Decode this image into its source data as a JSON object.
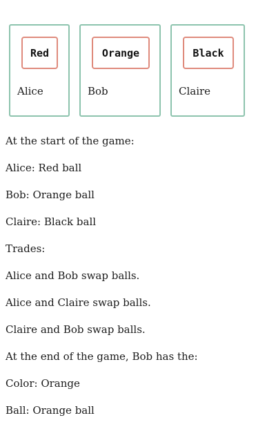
{
  "players": [
    {
      "name": "Alice",
      "ball": "Red"
    },
    {
      "name": "Bob",
      "ball": "Orange"
    },
    {
      "name": "Claire",
      "ball": "Black"
    }
  ],
  "colors": {
    "card_border": "#8cc3ad",
    "ball_border": "#df8a7c"
  },
  "text_lines": [
    "At the start of the game:",
    "Alice: Red ball",
    "Bob: Orange ball",
    "Claire: Black ball",
    "Trades:",
    "Alice and Bob swap balls.",
    "Alice and Claire swap balls.",
    "Claire and Bob swap balls.",
    "At the end of the game, Bob has the:",
    "Color: Orange",
    "Ball: Orange ball"
  ]
}
